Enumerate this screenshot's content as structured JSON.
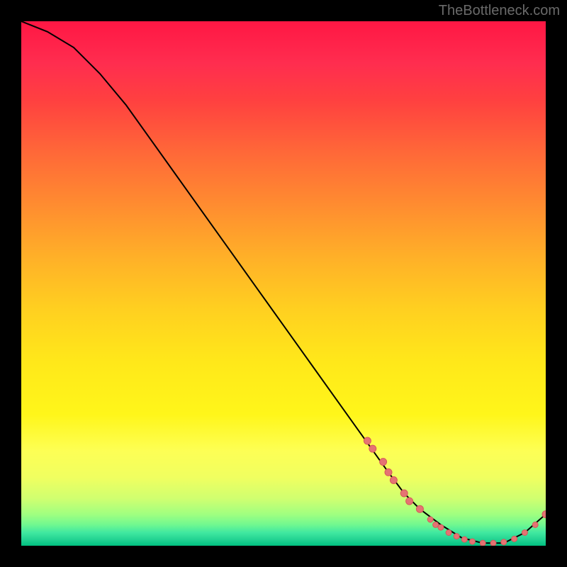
{
  "watermark": "TheBottleneck.com",
  "chart_data": {
    "type": "line",
    "title": "",
    "xlabel": "",
    "ylabel": "",
    "xlim": [
      0,
      100
    ],
    "ylim": [
      0,
      100
    ],
    "curve": {
      "x": [
        0,
        5,
        10,
        15,
        20,
        25,
        30,
        35,
        40,
        45,
        50,
        55,
        60,
        65,
        70,
        73,
        76,
        80,
        84,
        88,
        92,
        96,
        100
      ],
      "y": [
        100,
        98,
        95,
        90,
        84,
        77,
        70,
        63,
        56,
        49,
        42,
        35,
        28,
        21,
        14,
        10,
        7,
        4,
        1.5,
        0.5,
        0.5,
        2.5,
        6
      ]
    },
    "markers": [
      {
        "x": 66,
        "y": 20,
        "r": 5
      },
      {
        "x": 67,
        "y": 18.5,
        "r": 5
      },
      {
        "x": 69,
        "y": 16,
        "r": 5
      },
      {
        "x": 70,
        "y": 14,
        "r": 5
      },
      {
        "x": 71,
        "y": 12.5,
        "r": 5
      },
      {
        "x": 73,
        "y": 10,
        "r": 5
      },
      {
        "x": 74,
        "y": 8.5,
        "r": 5
      },
      {
        "x": 76,
        "y": 7,
        "r": 5
      },
      {
        "x": 78,
        "y": 5,
        "r": 4
      },
      {
        "x": 79,
        "y": 4,
        "r": 4
      },
      {
        "x": 80,
        "y": 3.5,
        "r": 4
      },
      {
        "x": 81.5,
        "y": 2.5,
        "r": 4
      },
      {
        "x": 83,
        "y": 1.8,
        "r": 4
      },
      {
        "x": 84.5,
        "y": 1.2,
        "r": 4
      },
      {
        "x": 86,
        "y": 0.8,
        "r": 4
      },
      {
        "x": 88,
        "y": 0.5,
        "r": 4
      },
      {
        "x": 90,
        "y": 0.5,
        "r": 4
      },
      {
        "x": 92,
        "y": 0.7,
        "r": 4
      },
      {
        "x": 94,
        "y": 1.3,
        "r": 4
      },
      {
        "x": 96,
        "y": 2.5,
        "r": 4
      },
      {
        "x": 98,
        "y": 4,
        "r": 4
      },
      {
        "x": 100,
        "y": 6,
        "r": 5
      }
    ],
    "colors": {
      "curve": "#000000",
      "marker_fill": "#e57373",
      "marker_stroke": "#d65a5a"
    }
  }
}
